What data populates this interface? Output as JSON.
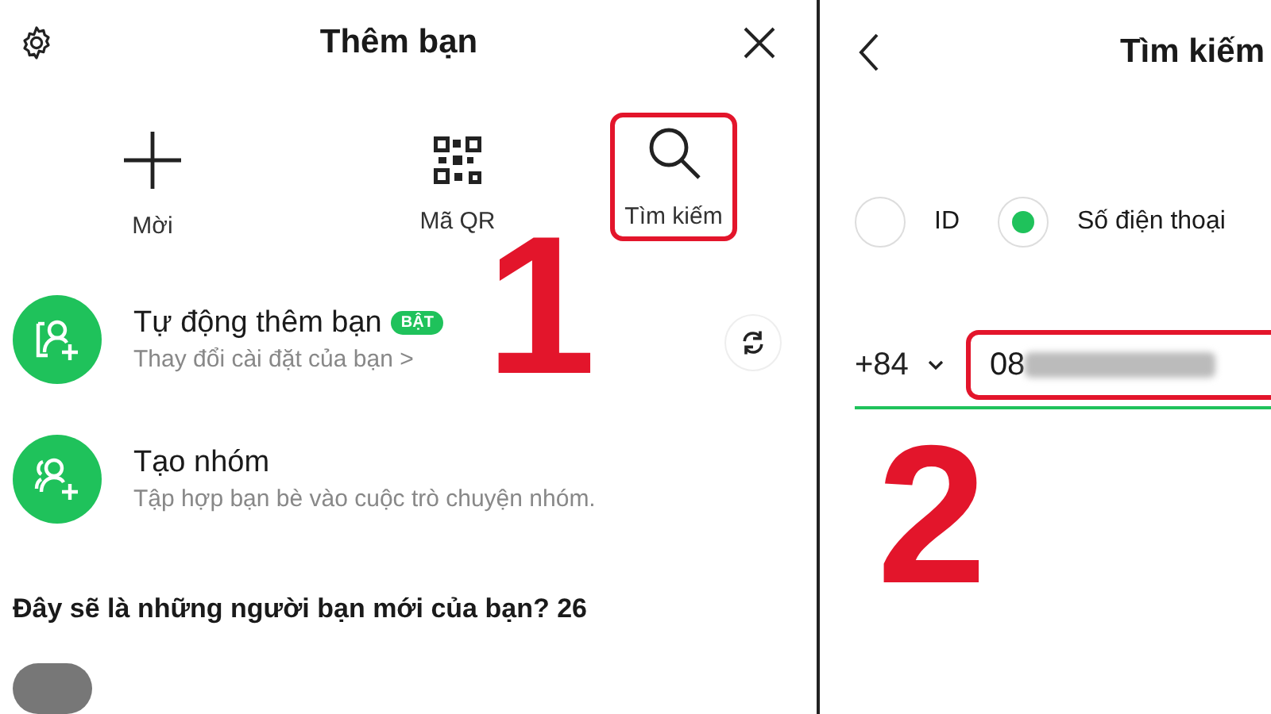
{
  "left_panel": {
    "title": "Thêm bạn",
    "actions": [
      {
        "label": "Mời",
        "kind": "plus",
        "highlighted": false
      },
      {
        "label": "Mã QR",
        "kind": "qr",
        "highlighted": false
      },
      {
        "label": "Tìm kiếm",
        "kind": "search",
        "highlighted": true
      }
    ],
    "options": [
      {
        "title": "Tự động thêm bạn",
        "badge": "BẬT",
        "subtitle": "Thay đổi cài đặt của bạn >",
        "kind": "auto-add"
      },
      {
        "title": "Tạo nhóm",
        "subtitle": "Tập hợp bạn bè vào cuộc trò chuyện nhóm.",
        "kind": "group"
      }
    ],
    "suggestions_heading": "Đây sẽ là những người bạn mới của bạn? 26"
  },
  "right_panel": {
    "title": "Tìm kiếm",
    "search_types": [
      {
        "label": "ID",
        "selected": false
      },
      {
        "label": "Số điện thoại",
        "selected": true
      }
    ],
    "country_code": "+84",
    "phone_value": "08",
    "phone_highlighted": true
  },
  "annotations": [
    "1",
    "2"
  ]
}
